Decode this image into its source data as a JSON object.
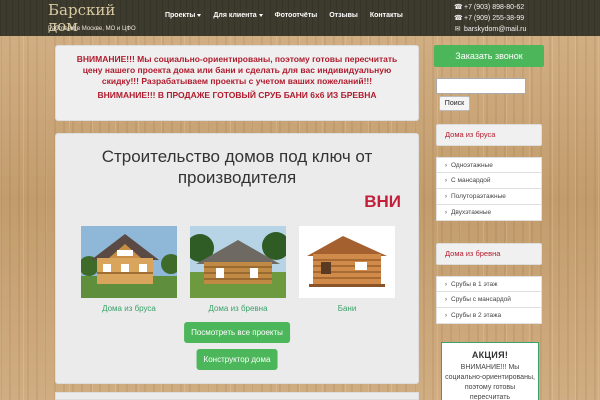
{
  "header": {
    "logo_line1": "Барский",
    "logo_line2": "дом",
    "tagline": "Работаем в Москве, МО и ЦФО",
    "nav": [
      {
        "label": "Проекты",
        "dropdown": true
      },
      {
        "label": "Для клиента",
        "dropdown": true
      },
      {
        "label": "Фотоотчёты",
        "dropdown": false
      },
      {
        "label": "Отзывы",
        "dropdown": false
      },
      {
        "label": "Контакты",
        "dropdown": false
      }
    ],
    "phone1": "+7 (903) 898-80-62",
    "phone2": "+7 (909) 255-38-99",
    "email": "barskydom@mail.ru"
  },
  "notice": {
    "text1": "ВНИМАНИЕ!!! Мы социально-ориентированы, поэтому готовы пересчитать цену нашего проекта дома или бани и сделать для вас индивидуальную скидку!!! Разрабатываем проекты с учетом ваших пожеланий!!!",
    "text2": "ВНИМАНИЕ!!! В ПРОДАЖЕ ГОТОВЫЙ СРУБ БАНИ 6х6 ИЗ БРЕВНА"
  },
  "hero": {
    "title": "Строительство домов под ключ от производителя",
    "marquee": "ВНИ",
    "products": [
      {
        "caption": "Дома из бруса"
      },
      {
        "caption": "Дома из бревна"
      },
      {
        "caption": "Бани"
      }
    ],
    "all_projects_btn": "Посмотреть все проекты",
    "constructor_btn": "Конструктор дома"
  },
  "sidebar": {
    "call_btn": "Заказать звонок",
    "search_btn": "Поиск",
    "widget1_title": "Дома из бруса",
    "widget1_items": [
      "Одноэтажные",
      "С мансардой",
      "Полутораэтажные",
      "Двухэтажные"
    ],
    "widget2_title": "Дома из бревна",
    "widget2_items": [
      "Срубы в 1 этаж",
      "Срубы с мансардой",
      "Срубы в 2 этажа"
    ],
    "promo_title": "АКЦИЯ!",
    "promo_text": "ВНИМАНИЕ!!! Мы социально-ориентированы, поэтому готовы пересчитать"
  }
}
